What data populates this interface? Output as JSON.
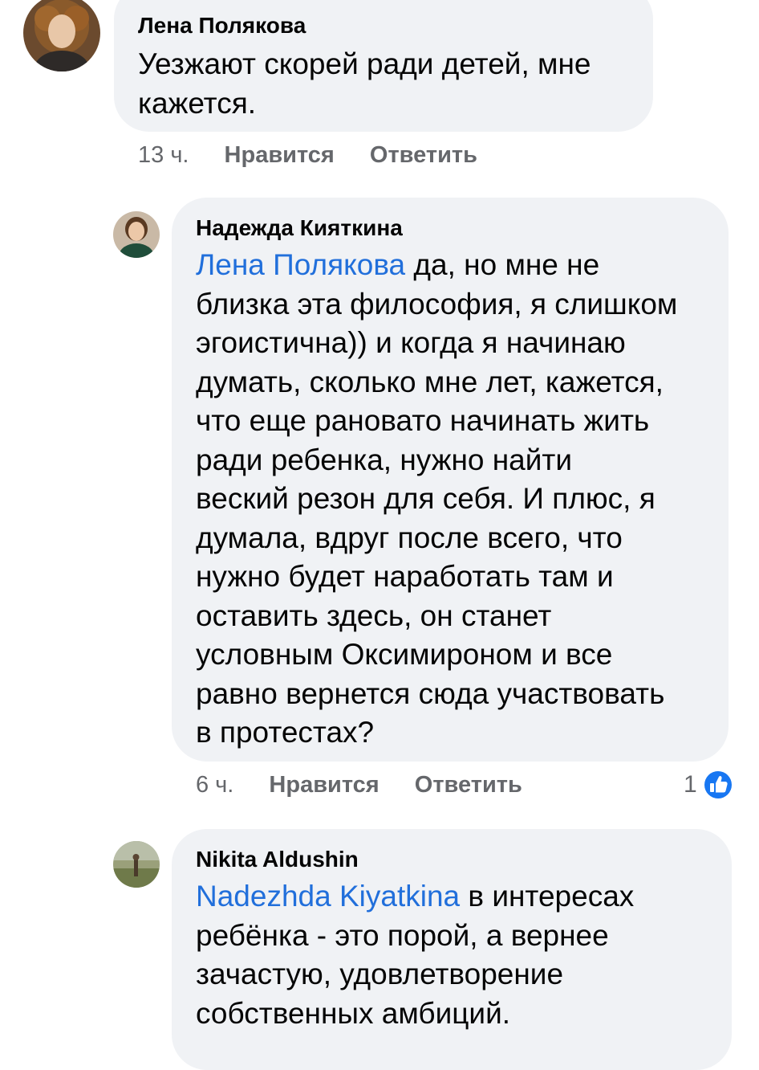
{
  "comments": [
    {
      "author": "Лена Полякова",
      "mention": "",
      "text": "Уезжают скорей ради детей, мне\nкажется.",
      "time": "13 ч.",
      "like_label": "Нравится",
      "reply_label": "Ответить",
      "reaction_count": ""
    },
    {
      "author": "Надежда Кияткина",
      "mention": "Лена Полякова",
      "text": " да, но мне не\nблизка эта философия, я слишком\nэгоистична)) и когда я начинаю\nдумать, сколько мне лет, кажется,\nчто еще рановато начинать жить\nради ребенка, нужно найти\nвеский резон для себя. И плюс, я\nдумала, вдруг после всего, что\nнужно будет наработать там и\nоставить здесь, он станет\nусловным Оксимироном и все\nравно вернется сюда участвовать\nв протестах?",
      "time": "6 ч.",
      "like_label": "Нравится",
      "reply_label": "Ответить",
      "reaction_count": "1",
      "reaction_icon": "like-icon",
      "reaction_color": "#1877f2"
    },
    {
      "author": "Nikita Aldushin",
      "mention": "Nadezhda Kiyatkina",
      "text": " в интересах\nребёнка - это порой, а вернее\nзачастую,  удовлетворение\nсобственных амбиций.",
      "time": "",
      "like_label": "",
      "reply_label": "",
      "reaction_count": ""
    }
  ],
  "colors": {
    "bubble": "#f0f2f5",
    "mention": "#216fdb",
    "meta": "#65676b",
    "like_blue": "#1877f2"
  }
}
